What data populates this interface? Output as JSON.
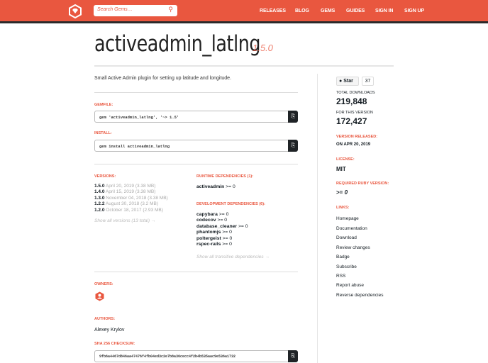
{
  "header": {
    "search_placeholder": "Search Gems…",
    "nav": [
      "RELEASES",
      "BLOG",
      "GEMS",
      "GUIDES",
      "SIGN IN",
      "SIGN UP"
    ]
  },
  "gem": {
    "name": "activeadmin_latlng",
    "version": "1.5.0",
    "description": "Small Active Admin plugin for setting up latitude and longitude."
  },
  "gemfile": {
    "label": "GEMFILE:",
    "value": "gem 'activeadmin_latlng', '~> 1.5'"
  },
  "install": {
    "label": "INSTALL:",
    "value": "gem install activeadmin_latlng"
  },
  "versions": {
    "label": "VERSIONS:",
    "items": [
      {
        "v": "1.5.0",
        "d": "April 20, 2019 (3.38 MB)"
      },
      {
        "v": "1.4.0",
        "d": "April 15, 2019 (3.38 MB)"
      },
      {
        "v": "1.3.0",
        "d": "November 04, 2018 (3.38 MB)"
      },
      {
        "v": "1.2.2",
        "d": "August 30, 2018 (3.2 MB)"
      },
      {
        "v": "1.2.0",
        "d": "October 18, 2017 (2.93 MB)"
      }
    ],
    "show_all": "Show all versions (13 total) →"
  },
  "runtime": {
    "label": "RUNTIME DEPENDENCIES (1):",
    "items": [
      {
        "n": "activeadmin",
        "r": ">= 0"
      }
    ]
  },
  "dev": {
    "label": "DEVELOPMENT DEPENDENCIES (6):",
    "items": [
      {
        "n": "capybara",
        "r": ">= 0"
      },
      {
        "n": "codecov",
        "r": ">= 0"
      },
      {
        "n": "database_cleaner",
        "r": ">= 0"
      },
      {
        "n": "phantomjs",
        "r": ">= 0"
      },
      {
        "n": "poltergeist",
        "r": ">= 0"
      },
      {
        "n": "rspec-rails",
        "r": ">= 0"
      }
    ],
    "show_all": "Show all transitive dependencies →"
  },
  "owners": {
    "label": "OWNERS:"
  },
  "authors": {
    "label": "AUTHORS:",
    "value": "Alexey Krylov"
  },
  "sha": {
    "label": "SHA 256 CHECKSUM:",
    "value": "9fb6a4467d846aa47476f4fb04ed3c2e7b8a36cecc4f2b4b535aac9e536a1732"
  },
  "sidebar": {
    "star": "Star",
    "star_count": "37",
    "total_label": "TOTAL DOWNLOADS",
    "total": "219,848",
    "version_label": "FOR THIS VERSION",
    "version_dl": "172,427",
    "released_label": "VERSION RELEASED:",
    "released": "ON APR 20, 2019",
    "license_label": "LICENSE:",
    "license": "MIT",
    "ruby_label": "REQUIRED RUBY VERSION:",
    "ruby_op": ">= ",
    "ruby_v": "0",
    "links_label": "LINKS:",
    "links": [
      "Homepage",
      "Documentation",
      "Download",
      "Review changes",
      "Badge",
      "Subscribe",
      "RSS",
      "Report abuse",
      "Reverse dependencies"
    ]
  },
  "colors": {
    "brand": "#e9573f"
  }
}
